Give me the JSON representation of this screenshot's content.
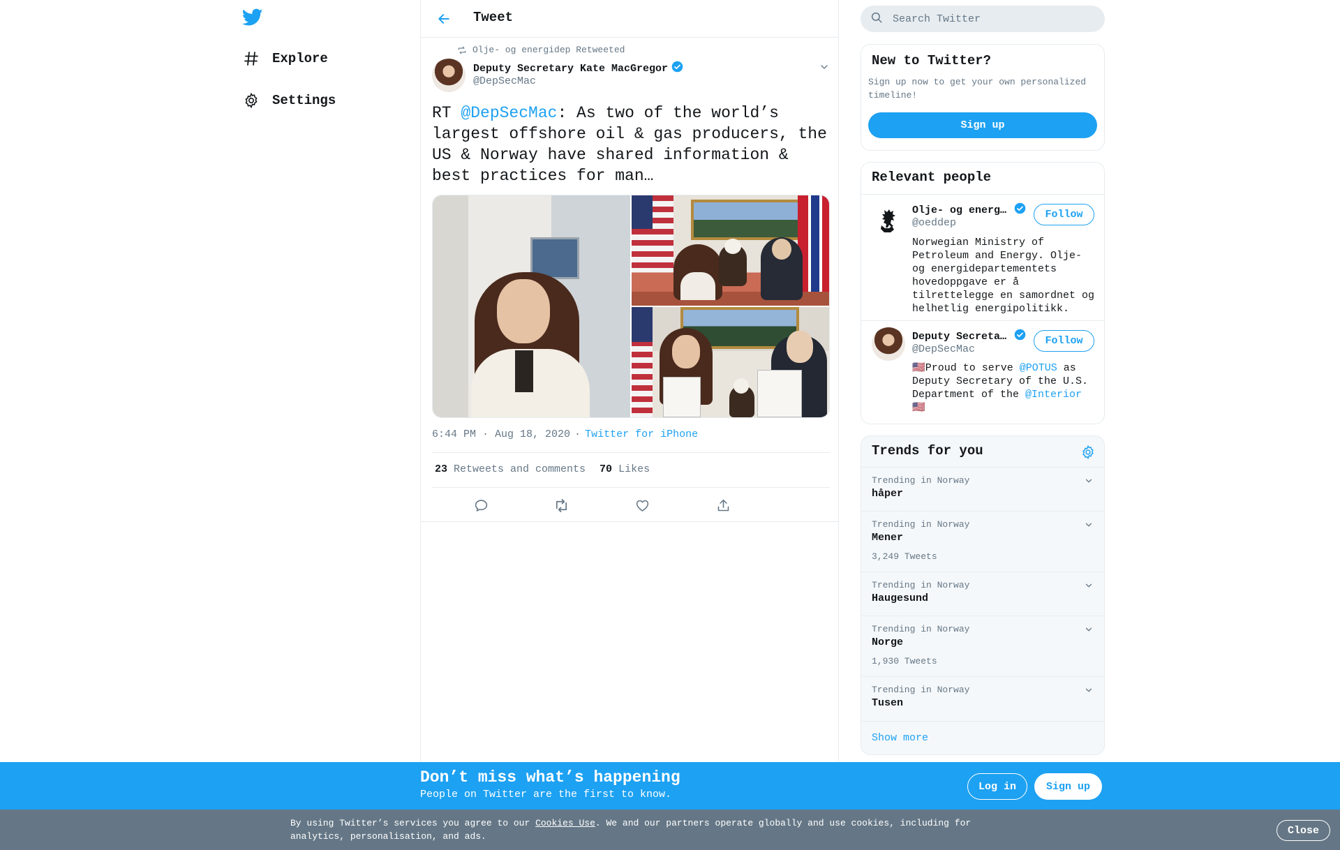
{
  "colors": {
    "accent": "#1da1f2",
    "text": "#14171a",
    "secondary": "#657786",
    "border": "#e6ecf0",
    "cookie_bar": "#657786"
  },
  "sidebar": {
    "logo_icon": "twitter-bird-icon",
    "items": [
      {
        "label": "Explore",
        "icon": "hashtag-icon"
      },
      {
        "label": "Settings",
        "icon": "gear-icon"
      }
    ]
  },
  "header": {
    "title": "Tweet",
    "back_icon": "back-arrow-icon"
  },
  "tweet": {
    "retweeted_by": "Olje- og energidep Retweeted",
    "author_name": "Deputy Secretary Kate MacGregor",
    "author_handle": "@DepSecMac",
    "text_prefix": "RT ",
    "text_mention": "@DepSecMac",
    "text_body": ": As two of the world’s largest offshore oil & gas producers, the US & Norway have shared information & best practices for man…",
    "time": "6:44 PM · Aug 18, 2020",
    "dot": "·",
    "source": "Twitter for iPhone",
    "retweets_count": "23",
    "retweets_label": "Retweets and comments",
    "likes_count": "70",
    "likes_label": "Likes",
    "actions": [
      "reply-icon",
      "retweet-icon",
      "like-icon",
      "share-icon"
    ]
  },
  "search": {
    "placeholder": "Search Twitter"
  },
  "new_to_twitter": {
    "title": "New to Twitter?",
    "text": "Sign up now to get your own personalized timeline!",
    "button": "Sign up"
  },
  "relevant_people": {
    "title": "Relevant people",
    "people": [
      {
        "name": "Olje- og energidep",
        "handle": "@oeddep",
        "follow": "Follow",
        "bio": "Norwegian Ministry of Petroleum and Energy. Olje- og energidepartementets hovedoppgave er å tilrettelegge en samordnet og helhetlig energipolitikk."
      },
      {
        "name": "Deputy Secretary Kate MacGregor",
        "handle": "@DepSecMac",
        "follow": "Follow",
        "bio_flag": "🇺🇸",
        "bio_a": "Proud to serve ",
        "bio_m1": "@POTUS",
        "bio_b": " as Deputy Secretary of the U.S. Department of the ",
        "bio_m2": "@Interior",
        "bio_flag2": "🇺🇸"
      }
    ]
  },
  "trends": {
    "title": "Trends for you",
    "items": [
      {
        "context": "Trending in Norway",
        "name": "håper",
        "count": ""
      },
      {
        "context": "Trending in Norway",
        "name": "Mener",
        "count": "3,249 Tweets"
      },
      {
        "context": "Trending in Norway",
        "name": "Haugesund",
        "count": ""
      },
      {
        "context": "Trending in Norway",
        "name": "Norge",
        "count": "1,930 Tweets"
      },
      {
        "context": "Trending in Norway",
        "name": "Tusen",
        "count": ""
      }
    ],
    "show_more": "Show more"
  },
  "banner": {
    "title": "Don’t miss what’s happening",
    "subtitle": "People on Twitter are the first to know.",
    "login": "Log in",
    "signup": "Sign up"
  },
  "cookie": {
    "text_a": "By using Twitter’s services you agree to our ",
    "link": "Cookies Use",
    "text_b": ". We and our partners operate globally and use cookies, including for analytics, personalisation, and ads.",
    "close": "Close"
  }
}
